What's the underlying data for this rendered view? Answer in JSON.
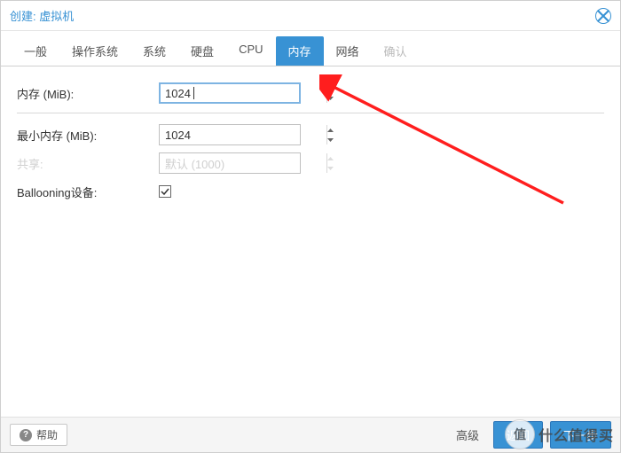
{
  "title": "创建: 虚拟机",
  "tabs": [
    {
      "label": "一般",
      "active": false
    },
    {
      "label": "操作系统",
      "active": false
    },
    {
      "label": "系统",
      "active": false
    },
    {
      "label": "硬盘",
      "active": false
    },
    {
      "label": "CPU",
      "active": false
    },
    {
      "label": "内存",
      "active": true
    },
    {
      "label": "网络",
      "active": false
    },
    {
      "label": "确认",
      "active": false,
      "disabled": true
    }
  ],
  "form": {
    "memory_label": "内存 (MiB):",
    "memory_value": "1024",
    "min_memory_label": "最小内存 (MiB):",
    "min_memory_value": "1024",
    "shares_label": "共享:",
    "shares_value": "默认 (1000)",
    "ballooning_label": "Ballooning设备:",
    "ballooning_checked": true
  },
  "footer": {
    "help_label": "帮助",
    "advanced_label": "高级",
    "back_label": "返回",
    "next_label": "下一步"
  },
  "watermark": {
    "circle": "值",
    "text": "什么值得买"
  }
}
